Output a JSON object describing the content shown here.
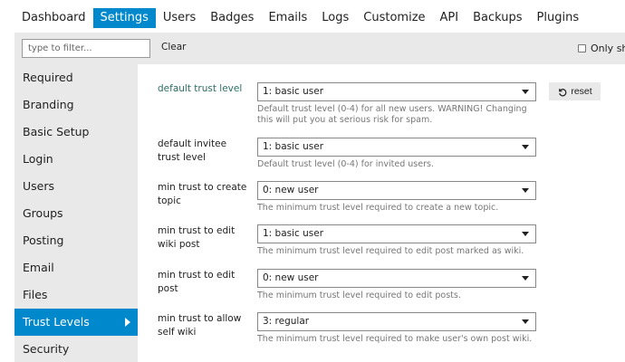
{
  "nav": {
    "tabs": [
      {
        "label": "Dashboard"
      },
      {
        "label": "Settings",
        "active": true
      },
      {
        "label": "Users"
      },
      {
        "label": "Badges"
      },
      {
        "label": "Emails"
      },
      {
        "label": "Logs"
      },
      {
        "label": "Customize"
      },
      {
        "label": "API"
      },
      {
        "label": "Backups"
      },
      {
        "label": "Plugins"
      }
    ]
  },
  "filter": {
    "placeholder": "type to filter...",
    "value": "",
    "clear_label": "Clear",
    "only_label": "Only sh",
    "only_checked": false
  },
  "sidebar": {
    "items": [
      {
        "label": "Required"
      },
      {
        "label": "Branding"
      },
      {
        "label": "Basic Setup"
      },
      {
        "label": "Login"
      },
      {
        "label": "Users"
      },
      {
        "label": "Groups"
      },
      {
        "label": "Posting"
      },
      {
        "label": "Email"
      },
      {
        "label": "Files"
      },
      {
        "label": "Trust Levels",
        "active": true
      },
      {
        "label": "Security"
      }
    ]
  },
  "settings": [
    {
      "label": "default trust level",
      "value": "1: basic user",
      "description": "Default trust level (0-4) for all new users. WARNING! Changing this will put you at serious risk for spam.",
      "changed": true,
      "reset_label": "reset"
    },
    {
      "label": "default invitee trust level",
      "value": "1: basic user",
      "description": "Default trust level (0-4) for invited users."
    },
    {
      "label": "min trust to create topic",
      "value": "0: new user",
      "description": "The minimum trust level required to create a new topic."
    },
    {
      "label": "min trust to edit wiki post",
      "value": "1: basic user",
      "description": "The minimum trust level required to edit post marked as wiki."
    },
    {
      "label": "min trust to edit post",
      "value": "0: new user",
      "description": "The minimum trust level required to edit posts."
    },
    {
      "label": "min trust to allow self wiki",
      "value": "3: regular",
      "description": "The minimum trust level required to make user's own post wiki."
    }
  ],
  "colors": {
    "accent": "#0088cc",
    "panel": "#e9e9e9",
    "changed_label": "#2c6e63",
    "muted_text": "#777777"
  },
  "icons": {
    "reset": "undo-icon",
    "select_caret": "caret-down-icon",
    "active_sidebar": "caret-right-icon"
  }
}
